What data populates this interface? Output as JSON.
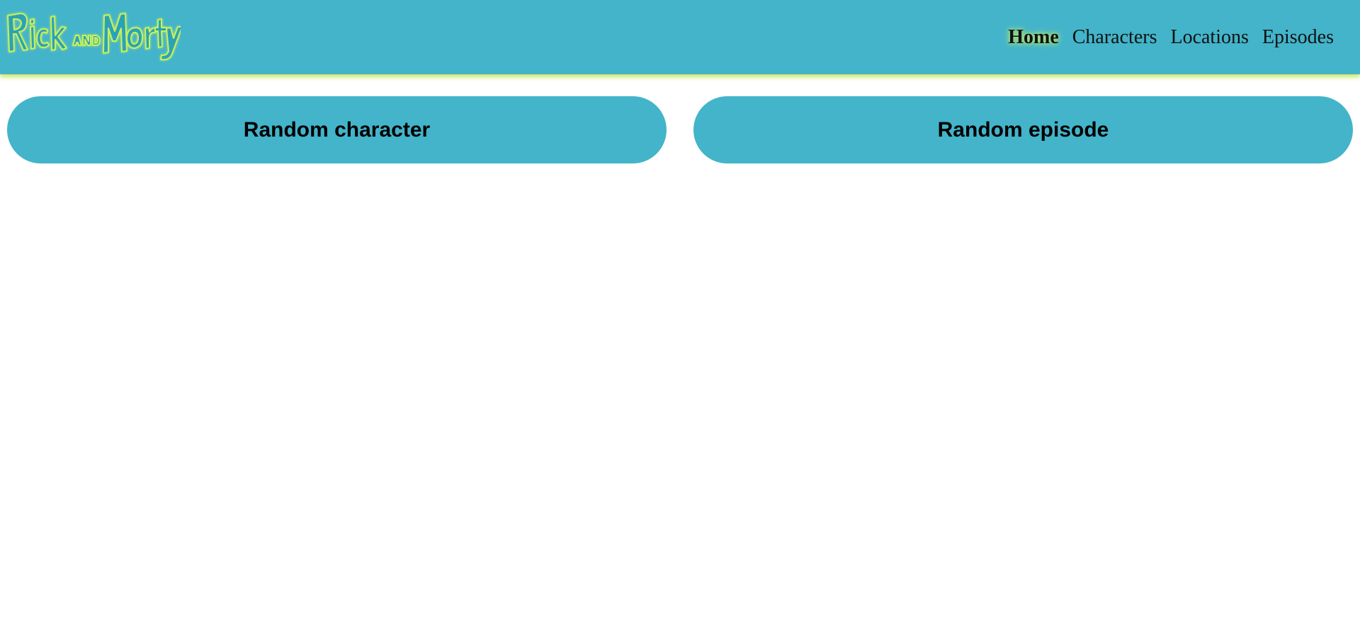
{
  "header": {
    "logo_text": "Rick and Morty",
    "nav": [
      {
        "label": "Home",
        "active": true
      },
      {
        "label": "Characters",
        "active": false
      },
      {
        "label": "Locations",
        "active": false
      },
      {
        "label": "Episodes",
        "active": false
      }
    ]
  },
  "main": {
    "buttons": [
      {
        "label": "Random character"
      },
      {
        "label": "Random episode"
      }
    ]
  },
  "colors": {
    "primary": "#43b4ca",
    "accent_glow": "#b9e86a",
    "text": "#111111",
    "background": "#ffffff"
  }
}
